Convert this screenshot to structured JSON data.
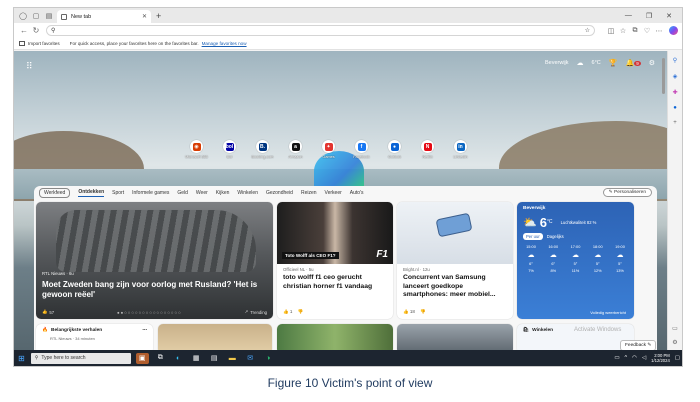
{
  "browser": {
    "tab_title": "New tab",
    "address_value": "",
    "favorites_bar": {
      "import_label": "Import favorites",
      "message": "For quick access, place your favorites here on the favorites bar.",
      "manage_link": "Manage favorites now"
    }
  },
  "newtab": {
    "location": "Beverwijk",
    "temperature": "6°C",
    "notification_count": "9",
    "quick_links": [
      {
        "label": "Microsoft 365",
        "glyph": "◉",
        "color": "#d83b01"
      },
      {
        "label": "Bol",
        "glyph": "bol",
        "color": "#0000a4"
      },
      {
        "label": "Booking.com",
        "glyph": "B.",
        "color": "#003580"
      },
      {
        "label": "Amazon",
        "glyph": "a",
        "color": "#111111"
      },
      {
        "label": "Games",
        "glyph": "✦",
        "color": "#e3342f"
      },
      {
        "label": "Facebook",
        "glyph": "f",
        "color": "#1877f2"
      },
      {
        "label": "Outlook",
        "glyph": "●",
        "color": "#0a64d6"
      },
      {
        "label": "Netflix",
        "glyph": "N",
        "color": "#e50914"
      },
      {
        "label": "LinkedIn",
        "glyph": "in",
        "color": "#0a66c2"
      }
    ]
  },
  "feed": {
    "nav": [
      "Werkfeed",
      "Ontdekken",
      "Sport",
      "Informele games",
      "Geld",
      "Weer",
      "Kijken",
      "Winkelen",
      "Gezondheid",
      "Reizen",
      "Verkeer",
      "Auto's"
    ],
    "personalize_label": "Personaliseren",
    "main_card": {
      "source": "RTL Nieuws · 6u",
      "headline": "Moet Zweden bang zijn voor oorlog met Rusland? 'Het is gewoon reëel'",
      "likes": "57",
      "trending_label": "Trending"
    },
    "card_f1": {
      "caption": "Toto Wolff als CEO F1?",
      "logo": "F1",
      "source": "Officieel NL · 5u",
      "headline": "toto wolff f1 ceo gerucht christian horner f1 vandaag",
      "likes": "1"
    },
    "card_phone": {
      "source": "Bright.nl · 12u",
      "headline": "Concurrent van Samsung lanceert goedkope smartphones: meer mobiel...",
      "likes": "18"
    },
    "weather": {
      "location": "Beverwijk",
      "temperature": "6",
      "unit": "°C",
      "condition": "Luchtkwaliteit 82 %",
      "tabs": [
        "Per uur",
        "Dagelijks"
      ],
      "hours": [
        {
          "time": "15:00",
          "temp": "6°",
          "rain": "7%"
        },
        {
          "time": "16:00",
          "temp": "6°",
          "rain": "8%"
        },
        {
          "time": "17:00",
          "temp": "5°",
          "rain": "11%"
        },
        {
          "time": "18:00",
          "temp": "5°",
          "rain": "12%"
        },
        {
          "time": "19:00",
          "temp": "5°",
          "rain": "13%"
        }
      ],
      "more_label": "Volledig weerbericht"
    },
    "bottom_left": {
      "title": "Belangrijkste verhalen",
      "source": "RTL Nieuws · 34 minuten"
    },
    "bottom_right": {
      "title": "Winkelen"
    }
  },
  "overlay": {
    "activate_windows": "Activate Windows",
    "feedback_label": "Feedback"
  },
  "taskbar": {
    "search_placeholder": "Type here to search",
    "time": "2:00 PM",
    "date": "1/12/2024"
  },
  "caption": "Figure 10 Victim's point of view"
}
